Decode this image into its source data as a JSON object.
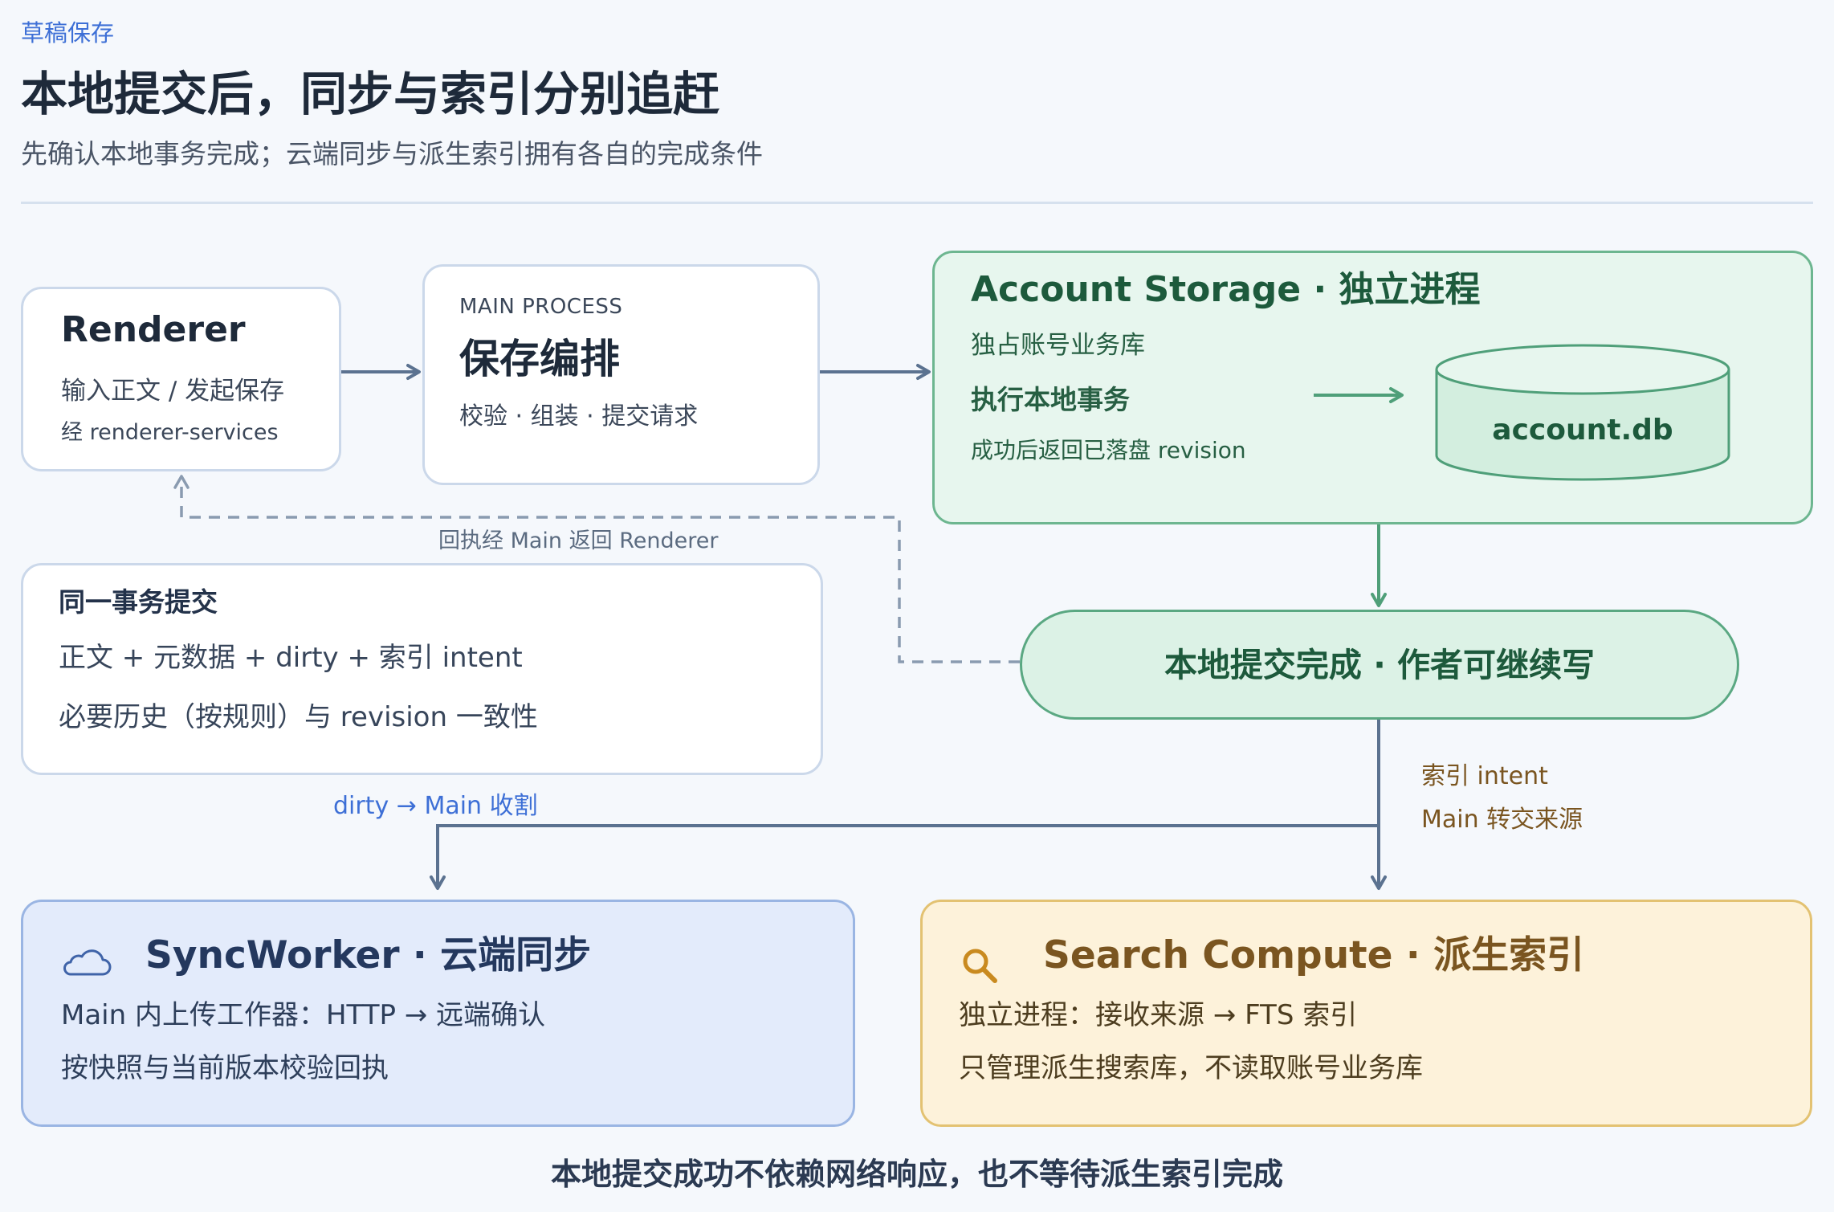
{
  "header": {
    "eyebrow": "草稿保存",
    "title": "本地提交后，同步与索引分别追赶",
    "subtitle": "先确认本地事务完成；云端同步与派生索引拥有各自的完成条件"
  },
  "renderer": {
    "title": "Renderer",
    "line1": "输入正文 / 发起保存",
    "line2": "经 renderer-services"
  },
  "main_process": {
    "eyebrow": "MAIN PROCESS",
    "title": "保存编排",
    "line1": "校验 · 组装 · 提交请求"
  },
  "account_storage": {
    "title": "Account Storage · 独立进程",
    "line1": "独占账号业务库",
    "line2": "执行本地事务",
    "line3": "成功后返回已落盘 revision",
    "db_label": "account.db"
  },
  "transaction": {
    "title": "同一事务提交",
    "line1": "正文 + 元数据 + dirty + 索引 intent",
    "line2": "必要历史（按规则）与 revision 一致性"
  },
  "local_commit": {
    "label": "本地提交完成 · 作者可继续写"
  },
  "sync_worker": {
    "icon": "cloud-icon",
    "title": "SyncWorker · 云端同步",
    "line1": "Main 内上传工作器：HTTP → 远端确认",
    "line2": "按快照与当前版本校验回执"
  },
  "search_compute": {
    "icon": "search-icon",
    "title": "Search Compute · 派生索引",
    "line1": "独立进程：接收来源 → FTS 索引",
    "line2": "只管理派生搜索库，不读取账号业务库"
  },
  "edges": {
    "receipt_label": "回执经 Main 返回 Renderer",
    "dirty_label": "dirty → Main 收割",
    "index_label_1": "索引 intent",
    "index_label_2": "Main 转交来源"
  },
  "footer": {
    "note": "本地提交成功不依赖网络响应，也不等待派生索引完成"
  },
  "colors": {
    "background": "#f5f8fc",
    "accent_blue": "#3d6fd6",
    "green": "#5aa882",
    "green_fill": "#e7f6ee",
    "slate_arrow": "#5b7290",
    "sync_fill": "#e3ebfb",
    "search_fill": "#fdf2da",
    "search_accent": "#c98a1f"
  }
}
